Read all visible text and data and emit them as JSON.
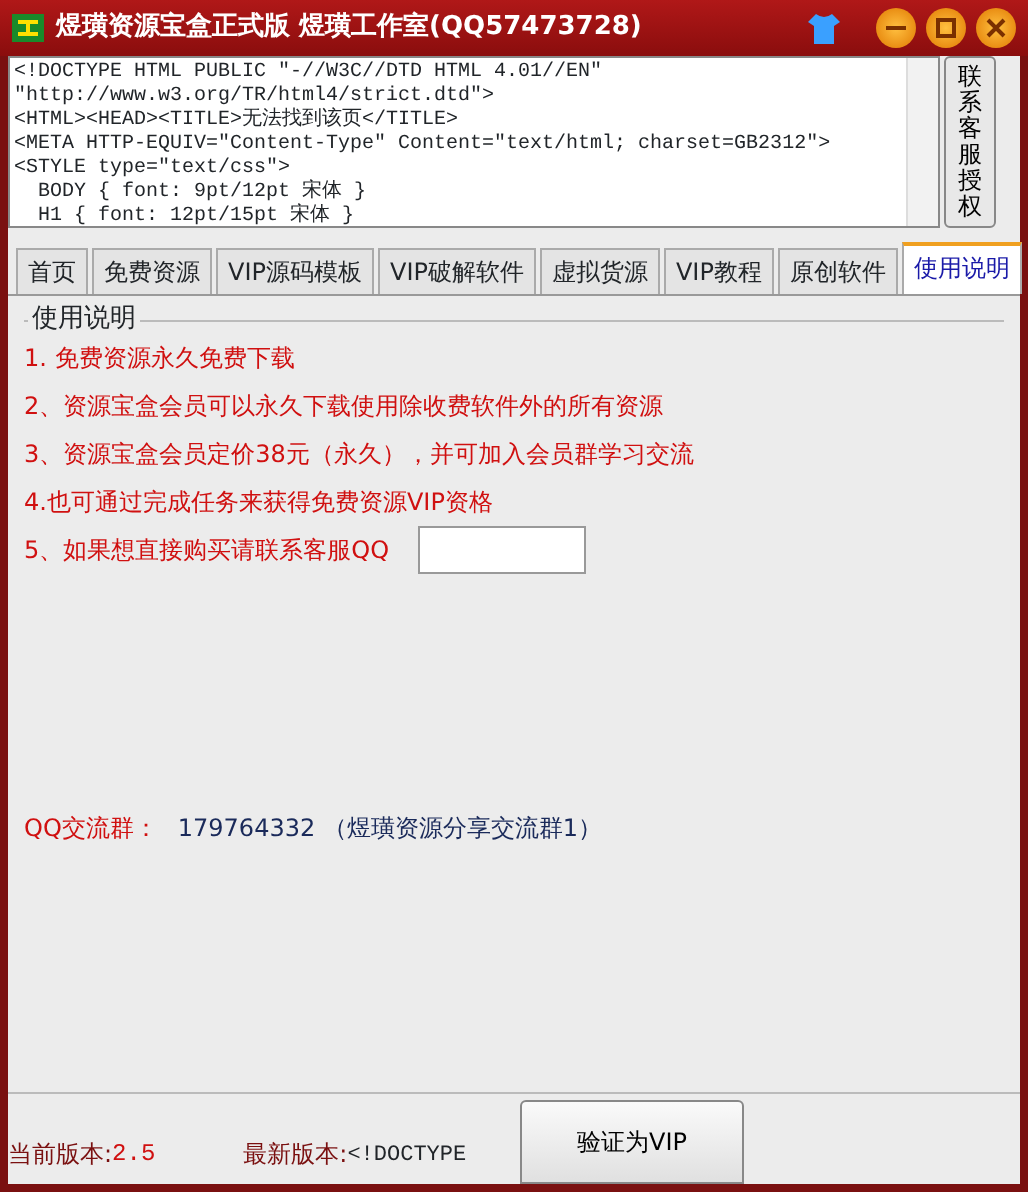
{
  "window": {
    "title": "煜璜资源宝盒正式版 煜璜工作室(QQ57473728)"
  },
  "source_text": [
    "<!DOCTYPE HTML PUBLIC \"-//W3C//DTD HTML 4.01//EN\"",
    "\"http://www.w3.org/TR/html4/strict.dtd\">",
    "<HTML><HEAD><TITLE>无法找到该页</TITLE>",
    "<META HTTP-EQUIV=\"Content-Type\" Content=\"text/html; charset=GB2312\">",
    "<STYLE type=\"text/css\">",
    "  BODY { font: 9pt/12pt 宋体 }",
    "  H1 { font: 12pt/15pt 宋体 }"
  ],
  "side_button": "联系客服授权",
  "tabs": [
    {
      "label": "首页",
      "selected": false
    },
    {
      "label": "免费资源",
      "selected": false
    },
    {
      "label": "VIP源码模板",
      "selected": false
    },
    {
      "label": "VIP破解软件",
      "selected": false
    },
    {
      "label": "虚拟货源",
      "selected": false
    },
    {
      "label": "VIP教程",
      "selected": false
    },
    {
      "label": "原创软件",
      "selected": false
    },
    {
      "label": "使用说明",
      "selected": true
    }
  ],
  "group_title": "使用说明",
  "notes": [
    "1. 免费资源永久免费下载",
    "2、资源宝盒会员可以永久下载使用除收费软件外的所有资源",
    "3、资源宝盒会员定价38元（永久），并可加入会员群学习交流",
    "4.也可通过完成任务来获得免费资源VIP资格",
    "5、如果想直接购买请联系客服QQ"
  ],
  "qq_group": {
    "label": "QQ交流群：",
    "value": "179764332 （煜璜资源分享交流群1）"
  },
  "status": {
    "current_label": "当前版本:",
    "current_value": "2.5",
    "latest_label": "最新版本:",
    "latest_value": "<!DOCTYPE"
  },
  "verify_button": "验证为VIP"
}
